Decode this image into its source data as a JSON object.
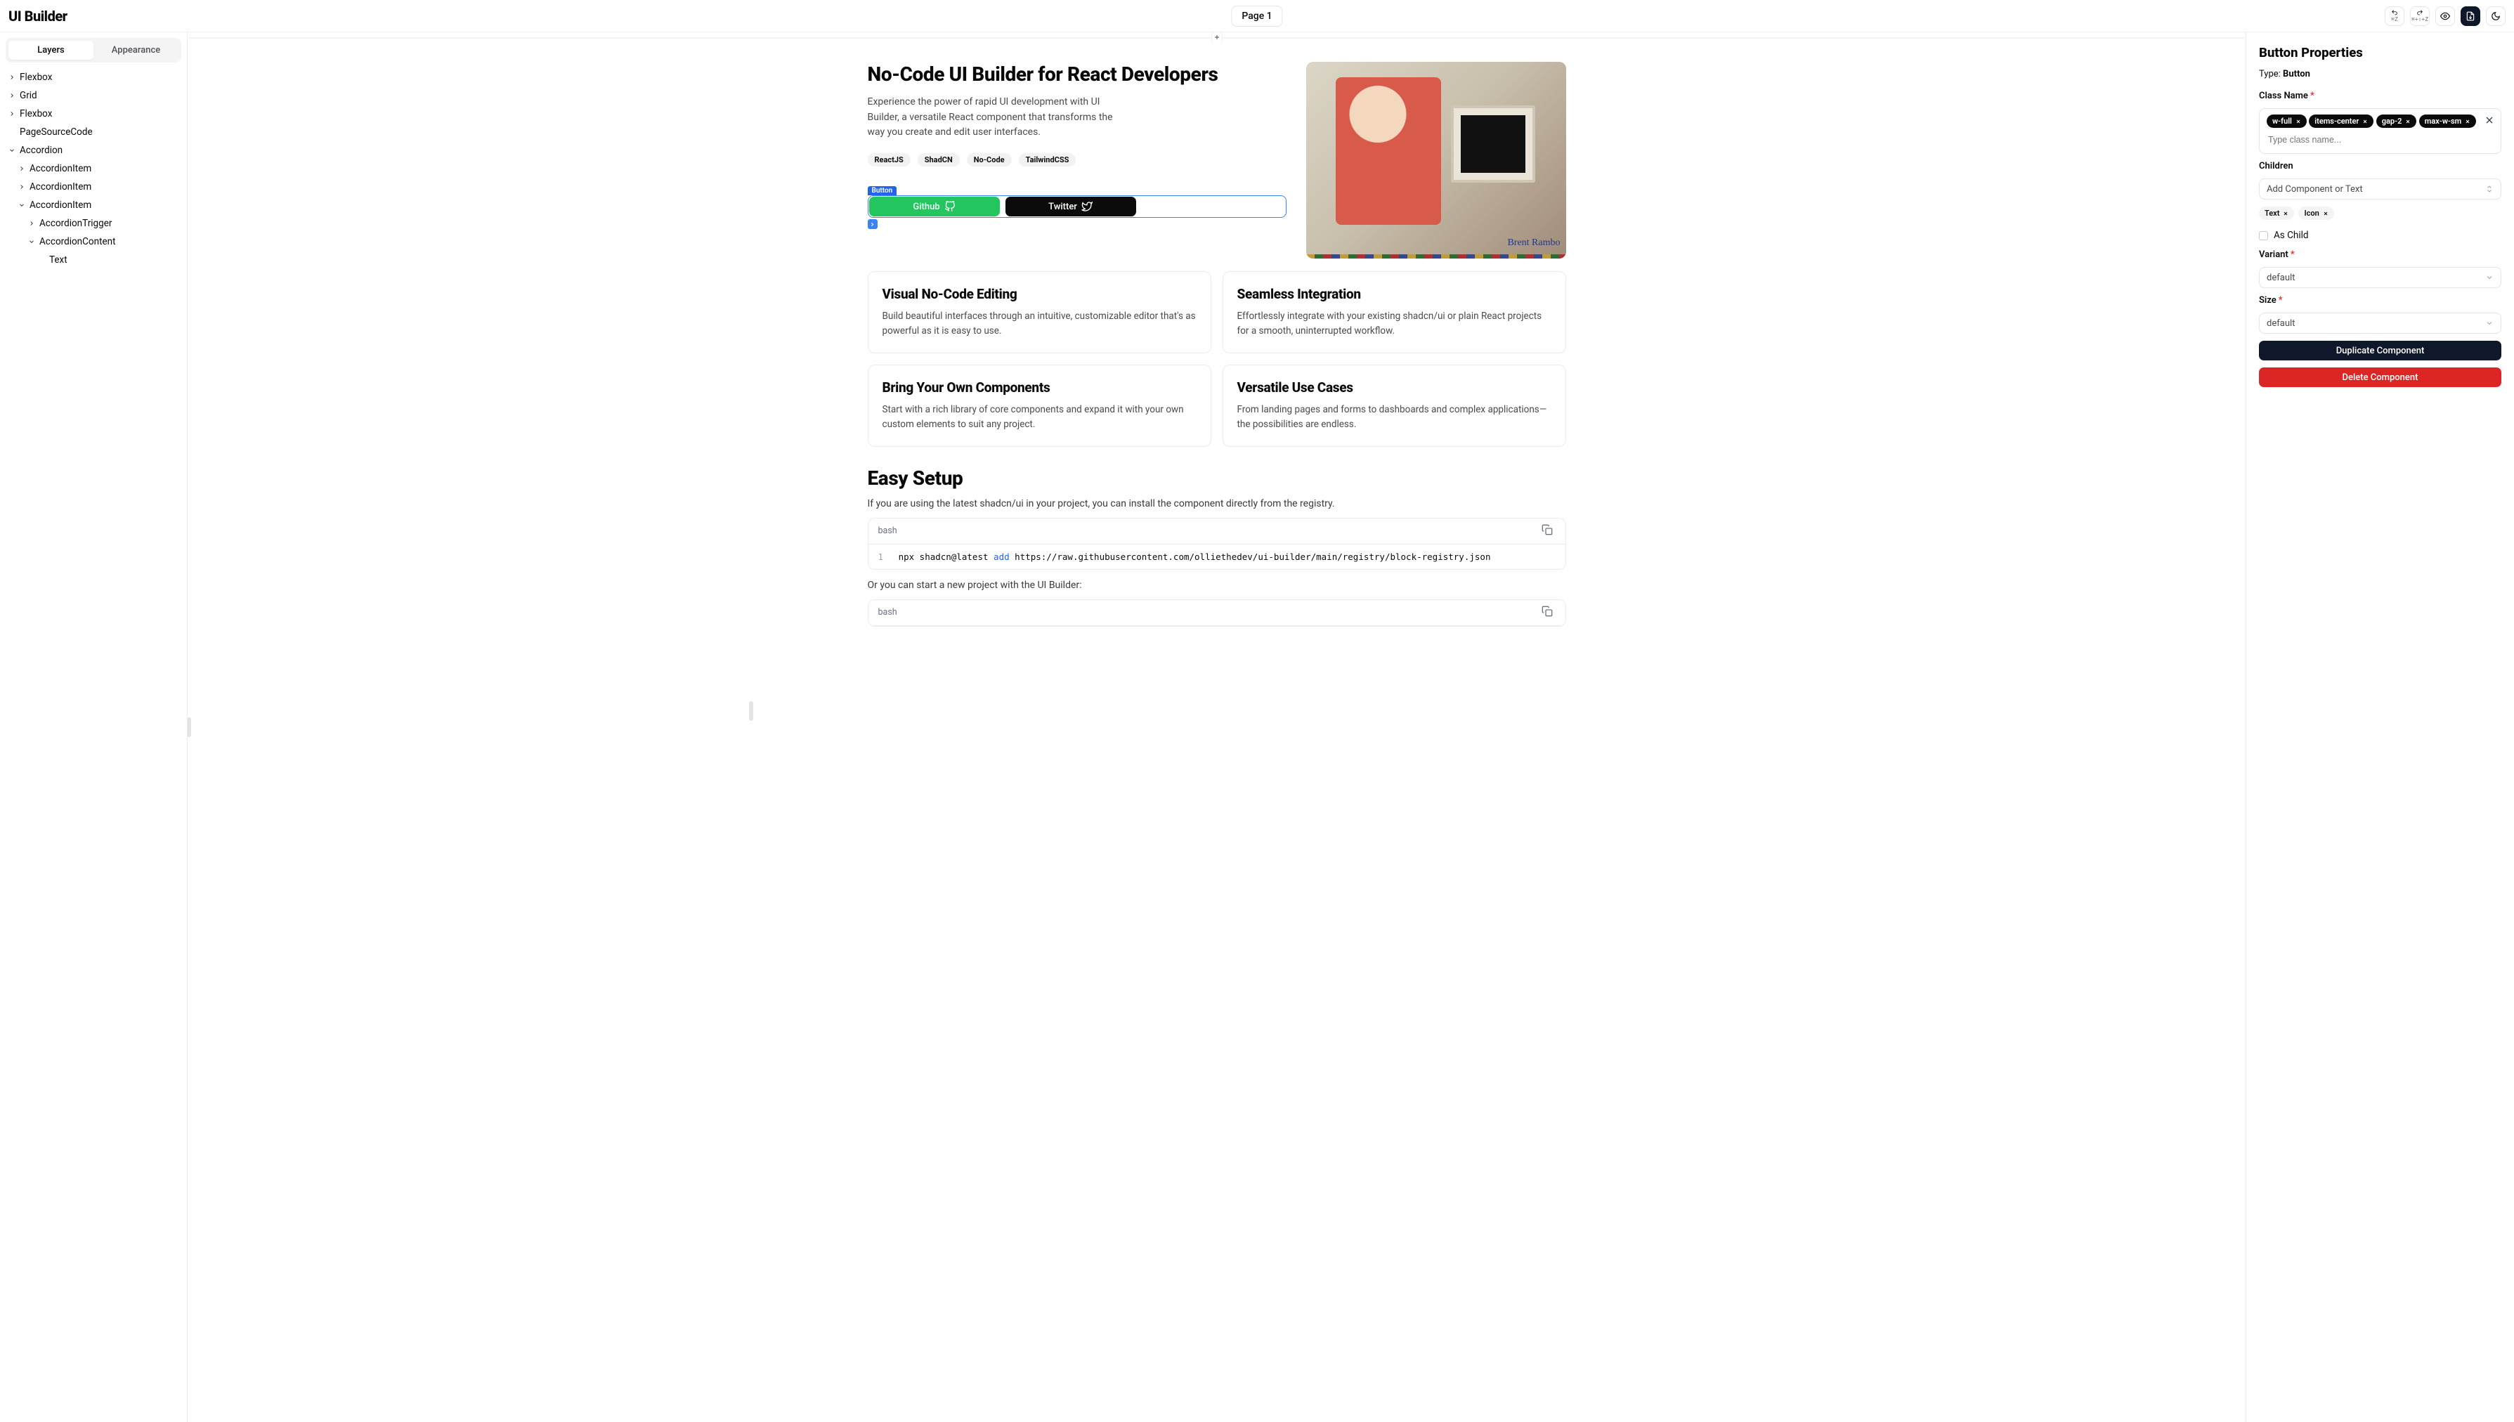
{
  "app_title": "UI Builder",
  "page_label": "Page 1",
  "undo_kbd": "⌘Z",
  "redo_kbd": "⌘+⇧+Z",
  "left_tabs": {
    "layers": "Layers",
    "appearance": "Appearance"
  },
  "tree": [
    {
      "depth": 0,
      "chevron": "right",
      "label": "Flexbox"
    },
    {
      "depth": 0,
      "chevron": "right",
      "label": "Grid"
    },
    {
      "depth": 0,
      "chevron": "right",
      "label": "Flexbox"
    },
    {
      "depth": 0,
      "chevron": "none",
      "label": "PageSourceCode"
    },
    {
      "depth": 0,
      "chevron": "down",
      "label": "Accordion"
    },
    {
      "depth": 1,
      "chevron": "right",
      "label": "AccordionItem"
    },
    {
      "depth": 1,
      "chevron": "right",
      "label": "AccordionItem"
    },
    {
      "depth": 1,
      "chevron": "down",
      "label": "AccordionItem"
    },
    {
      "depth": 2,
      "chevron": "right",
      "label": "AccordionTrigger"
    },
    {
      "depth": 2,
      "chevron": "down",
      "label": "AccordionContent"
    },
    {
      "depth": 3,
      "chevron": "none",
      "label": "Text"
    }
  ],
  "hero": {
    "h1": "No-Code UI Builder for React Developers",
    "sub": "Experience the power of rapid UI development with UI Builder, a versatile React component that transforms the way you create and edit user interfaces.",
    "badges": [
      "ReactJS",
      "ShadCN",
      "No-Code",
      "TailwindCSS"
    ],
    "selected_tag": "Button",
    "cta_primary": "Github",
    "cta_secondary": "Twitter",
    "img_signature": "Brent Rambo"
  },
  "cards": [
    {
      "title": "Visual No-Code Editing",
      "body": "Build beautiful interfaces through an intuitive, customizable editor that's as powerful as it is easy to use."
    },
    {
      "title": "Seamless Integration",
      "body": "Effortlessly integrate with your existing shadcn/ui or plain React projects for a smooth, uninterrupted workflow."
    },
    {
      "title": "Bring Your Own Components",
      "body": "Start with a rich library of core components and expand it with your own custom elements to suit any project."
    },
    {
      "title": "Versatile Use Cases",
      "body": "From landing pages and forms to dashboards and complex applications—the possibilities are endless."
    }
  ],
  "setup": {
    "h2": "Easy Setup",
    "line1": "If you are using the latest shadcn/ui in your project, you can install the component directly from the registry.",
    "line2": "Or you can start a new project with the UI Builder:",
    "code_lang": "bash",
    "code1": {
      "ln": "1",
      "a": "npx",
      "b": "shadcn@latest",
      "cmd": "add",
      "c": "https://raw.githubusercontent.com/olliethedev/ui-builder/main/registry/block-registry.json"
    }
  },
  "props": {
    "title": "Button Properties",
    "type_label": "Type:",
    "type_value": "Button",
    "class_label": "Class Name",
    "class_tags": [
      "w-full",
      "items-center",
      "gap-2",
      "max-w-sm"
    ],
    "class_placeholder": "Type class name...",
    "children_label": "Children",
    "children_select": "Add Component or Text",
    "children_chips": [
      "Text",
      "Icon"
    ],
    "as_child_label": "As Child",
    "variant_label": "Variant",
    "variant_value": "default",
    "size_label": "Size",
    "size_value": "default",
    "duplicate_btn": "Duplicate Component",
    "delete_btn": "Delete Component"
  }
}
